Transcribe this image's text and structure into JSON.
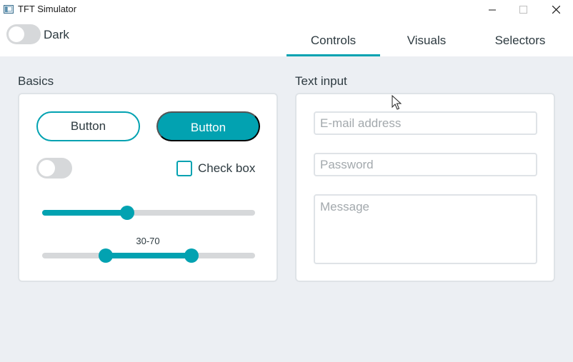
{
  "window": {
    "title": "TFT Simulator",
    "icon": "app-window-icon",
    "controls": [
      "minimize-icon",
      "maximize-icon",
      "close-icon"
    ]
  },
  "header": {
    "dark_toggle": {
      "label": "Dark",
      "on": false
    },
    "tabs": [
      {
        "label": "Controls",
        "active": true
      },
      {
        "label": "Visuals",
        "active": false
      },
      {
        "label": "Selectors",
        "active": false
      }
    ]
  },
  "basics": {
    "title": "Basics",
    "outline_button_label": "Button",
    "filled_button_label": "Button",
    "switch_on": false,
    "checkbox": {
      "label": "Check box",
      "checked": false
    },
    "slider": {
      "value_fraction": 0.4
    },
    "range_slider": {
      "label": "30-70",
      "low_fraction": 0.3,
      "high_fraction": 0.7
    }
  },
  "text_input": {
    "title": "Text input",
    "email_placeholder": "E-mail address",
    "password_placeholder": "Password",
    "message_placeholder": "Message"
  },
  "colors": {
    "accent": "#02a2b1",
    "background": "#eceff3",
    "track": "#d6d8da",
    "text": "#2d3a40"
  }
}
